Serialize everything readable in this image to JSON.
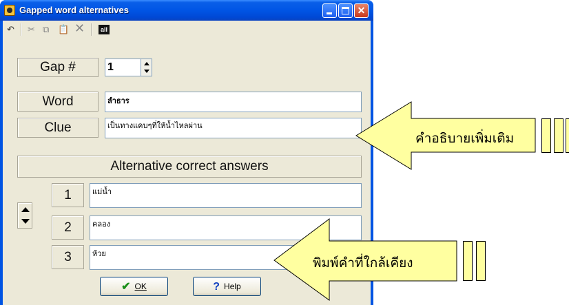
{
  "window": {
    "title": "Gapped word alternatives"
  },
  "toolbar": {
    "all_label": "all"
  },
  "gap": {
    "label": "Gap #",
    "value": "1"
  },
  "word": {
    "label": "Word",
    "value": "ลำธาร"
  },
  "clue": {
    "label": "Clue",
    "value": "เป็นทางแคบๆที่ให้น้ำไหลผ่าน"
  },
  "alternatives": {
    "header": "Alternative correct answers",
    "items": [
      {
        "number": "1",
        "value": "แม่น้ำ"
      },
      {
        "number": "2",
        "value": "คลอง"
      },
      {
        "number": "3",
        "value": "ห้วย"
      }
    ]
  },
  "buttons": {
    "ok": "OK",
    "help": "Help"
  },
  "callouts": {
    "clue_note": "คำอธิบายเพิ่มเติม",
    "alternatives_note": "พิมพ์คำที่ใกล้เคียง"
  },
  "colors": {
    "callout_fill": "#ffffa0",
    "titlebar": "#0055e5",
    "dialog_bg": "#ece9d8"
  }
}
